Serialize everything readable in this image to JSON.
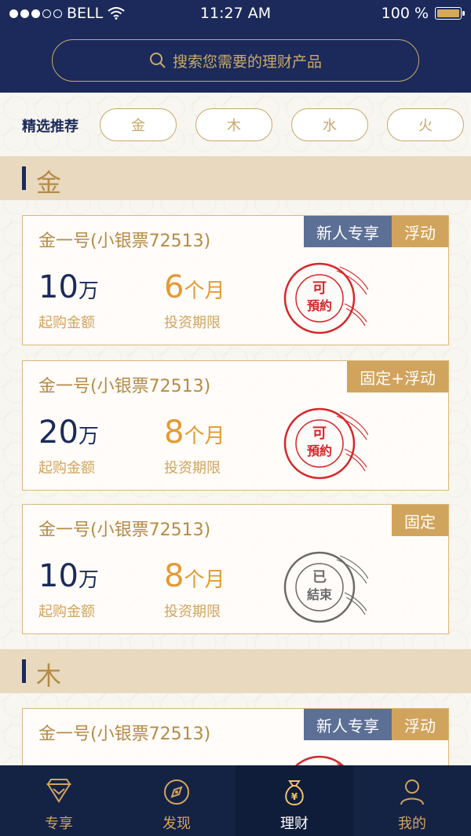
{
  "status": {
    "carrier": "BELL",
    "time": "11:27 AM",
    "battery": "100 %"
  },
  "search": {
    "placeholder": "搜索您需要的理财产品"
  },
  "filters": {
    "label": "精选推荐",
    "chips": [
      "金",
      "木",
      "水",
      "火"
    ]
  },
  "sections": [
    {
      "title": "金",
      "cards": [
        {
          "name": "金一号(小银票72513)",
          "tags": [
            "新人专享",
            "浮动"
          ],
          "amount": "10",
          "amount_unit": "万",
          "amount_label": "起购金额",
          "period": "6",
          "period_unit": "个月",
          "period_label": "投资期限",
          "stamp": "可预約",
          "stamp_color": "#d6262a"
        },
        {
          "name": "金一号(小银票72513)",
          "tags": [
            "固定+浮动"
          ],
          "amount": "20",
          "amount_unit": "万",
          "amount_label": "起购金额",
          "period": "8",
          "period_unit": "个月",
          "period_label": "投资期限",
          "stamp": "可预約",
          "stamp_color": "#d6262a"
        },
        {
          "name": "金一号(小银票72513)",
          "tags": [
            "固定"
          ],
          "amount": "10",
          "amount_unit": "万",
          "amount_label": "起购金额",
          "period": "8",
          "period_unit": "个月",
          "period_label": "投资期限",
          "stamp": "已結束",
          "stamp_color": "#6b6b6b"
        }
      ]
    },
    {
      "title": "木",
      "cards": [
        {
          "name": "金一号(小银票72513)",
          "tags": [
            "新人专享",
            "浮动"
          ],
          "stamp_color": "#d6262a"
        }
      ]
    }
  ],
  "tabbar": [
    {
      "label": "专享",
      "icon": "diamond-icon"
    },
    {
      "label": "发现",
      "icon": "compass-icon"
    },
    {
      "label": "理财",
      "icon": "money-bag-icon"
    },
    {
      "label": "我的",
      "icon": "user-icon"
    }
  ],
  "colors": {
    "navy": "#1b2a5a",
    "gold": "#d1a45e",
    "orange": "#e39a34",
    "stamp_red": "#d6262a"
  }
}
